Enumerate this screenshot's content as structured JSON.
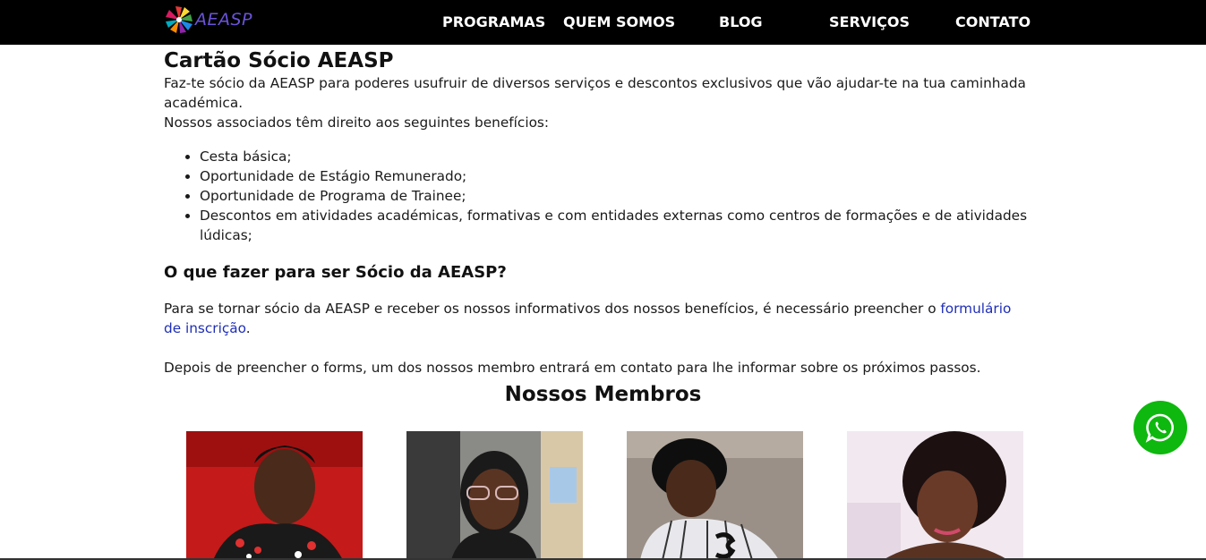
{
  "header": {
    "logo_text": "AEASP",
    "nav": [
      {
        "label": "PROGRAMAS"
      },
      {
        "label": "QUEM SOMOS"
      },
      {
        "label": "BLOG"
      },
      {
        "label": "SERVIÇOS"
      },
      {
        "label": "CONTATO"
      }
    ]
  },
  "main": {
    "title": "Cartão Sócio AEASP",
    "intro": "Faz-te sócio da AEASP para poderes usufruir de diversos serviços e descontos exclusivos que vão ajudar-te na tua caminhada académica.",
    "benefits_intro": "Nossos associados têm direito aos seguintes benefícios:",
    "benefits": [
      "Cesta básica;",
      "Oportunidade de Estágio Remunerado;",
      "Oportunidade de Programa de Trainee;",
      "Descontos em atividades académicas, formativas e com entidades externas como centros de formações e de atividades lúdicas;"
    ],
    "how_title": "O que fazer para ser Sócio da AEASP?",
    "how_text_before": "Para se tornar sócio da AEASP e receber os nossos informativos dos nossos benefícios, é necessário preencher o ",
    "how_link": "formulário de inscrição",
    "how_text_after": ".",
    "after_form": "Depois de preencher o forms, um dos nossos membro entrará em contato para lhe informar sobre os próximos passos."
  },
  "members": {
    "title": "Nossos Membros"
  },
  "icons": {
    "whatsapp": "whatsapp-icon",
    "logo": "aeasp-logo-icon"
  },
  "colors": {
    "navbar_bg": "#000000",
    "logo_text": "#6b53d8",
    "link": "#1f2fb8",
    "whatsapp_green": "#0eb80e"
  }
}
